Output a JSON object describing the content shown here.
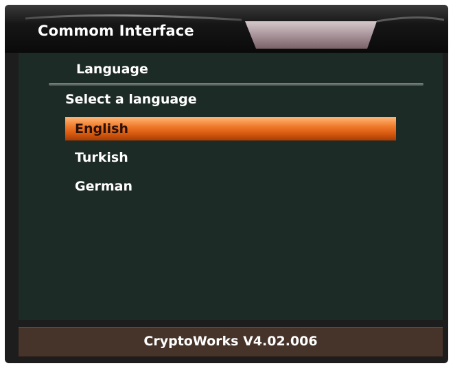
{
  "header": {
    "title": "Commom Interface"
  },
  "menu": {
    "title": "Language",
    "prompt": "Select a language",
    "options": [
      {
        "label": "English",
        "selected": true
      },
      {
        "label": "Turkish",
        "selected": false
      },
      {
        "label": "German",
        "selected": false
      }
    ]
  },
  "footer": {
    "version": "CryptoWorks V4.02.006"
  },
  "colors": {
    "panel_background": "#1d2b26",
    "selection_highlight": "#f07a2a",
    "footer_background": "#46342a"
  }
}
